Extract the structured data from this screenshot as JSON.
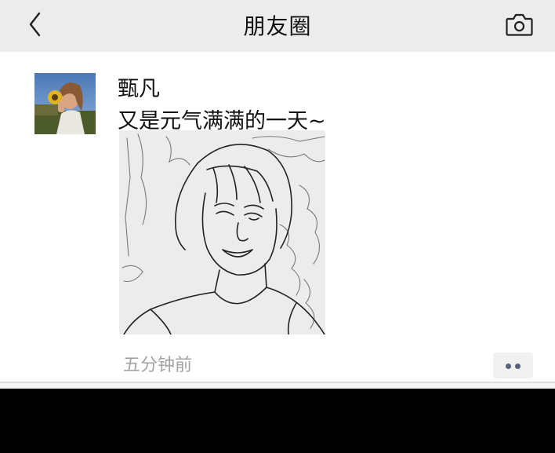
{
  "nav": {
    "title": "朋友圈",
    "back_icon": "chevron-left-icon",
    "camera_icon": "camera-icon"
  },
  "post": {
    "author": "甄凡",
    "text": "又是元气满满的一天~",
    "timestamp": "五分钟前",
    "more_icon": "more-dots-icon",
    "image": "line-drawing-portrait"
  },
  "colors": {
    "nav_bg": "#ececec",
    "timestamp": "#a3a3a3",
    "more_dots": "#55637a"
  }
}
